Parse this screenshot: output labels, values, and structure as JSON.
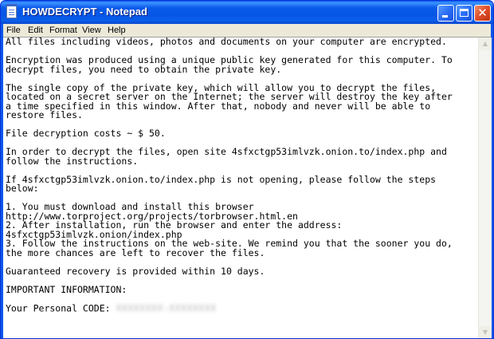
{
  "window": {
    "title": "HOWDECRYPT - Notepad",
    "close_glyph": "✕",
    "up_arrow": "▲",
    "down_arrow": "▼"
  },
  "menu": {
    "items": [
      "File",
      "Edit",
      "Format",
      "View",
      "Help"
    ]
  },
  "document": {
    "lines": [
      "All files including videos, photos and documents on your computer are encrypted.",
      "",
      "Encryption was produced using a unique public key generated for this computer. To",
      "decrypt files, you need to obtain the private key.",
      "",
      "The single copy of the private key, which will allow you to decrypt the files,",
      "located on a secret server on the Internet; the server will destroy the key after",
      "a time specified in this window. After that, nobody and never will be able to",
      "restore files.",
      "",
      "File decryption costs ~ $ 50.",
      "",
      "In order to decrypt the files, open site 4sfxctgp53imlvzk.onion.to/index.php and",
      "follow the instructions.",
      "",
      "If 4sfxctgp53imlvzk.onion.to/index.php is not opening, please follow the steps",
      "below:",
      "",
      "1. You must download and install this browser",
      "http://www.torproject.org/projects/torbrowser.html.en",
      "2. After installation, run the browser and enter the address:",
      "4sfxctgp53imlvzk.onion/index.php",
      "3. Follow the instructions on the web-site. We remind you that the sooner you do,",
      "the more chances are left to recover the files.",
      "",
      "Guaranteed recovery is provided within 10 days.",
      "",
      "IMPORTANT INFORMATION:",
      ""
    ],
    "code_label": "Your Personal CODE: ",
    "code_value": "XXXXXXXX-XXXXXXXX"
  }
}
